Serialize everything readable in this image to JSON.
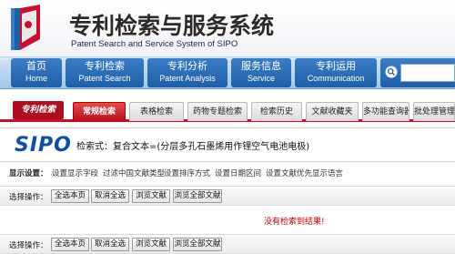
{
  "header": {
    "title_cn": "专利检索与服务系统",
    "title_en": "Patent Search and Service System of SIPO"
  },
  "mainnav": [
    {
      "cn": "首页",
      "en": "Home"
    },
    {
      "cn": "专利检索",
      "en": "Patent Search"
    },
    {
      "cn": "专利分析",
      "en": "Patent Analysis"
    },
    {
      "cn": "服务信息",
      "en": "Service"
    },
    {
      "cn": "专利运用",
      "en": "Communication"
    }
  ],
  "tabs": {
    "logo": "专利检索",
    "items": [
      "常规检索",
      "表格检索",
      "药物专题检索",
      "检索历史",
      "文献收藏夹",
      "多功能查询器",
      "批处理管理"
    ]
  },
  "query": {
    "brand": "SIPO",
    "text": "检索式：复合文本=(分层多孔石墨烯用作锂空气电池电极)"
  },
  "settings": {
    "label": "显示设置：",
    "links": [
      "设置显示字段",
      "过滤中国文献类型",
      "设置排序方式",
      "设置日期区间",
      "设置文献优先显示语言"
    ]
  },
  "operations": {
    "label": "选择操作：",
    "buttons": [
      "全选本页",
      "取消全选",
      "浏览文献",
      "浏览全部文献"
    ]
  },
  "no_result": "没有检索到结果!",
  "colors": {
    "nav_blue": "#1f5fa8",
    "accent_red": "#c8102e",
    "brand_blue": "#0f4fa0"
  }
}
